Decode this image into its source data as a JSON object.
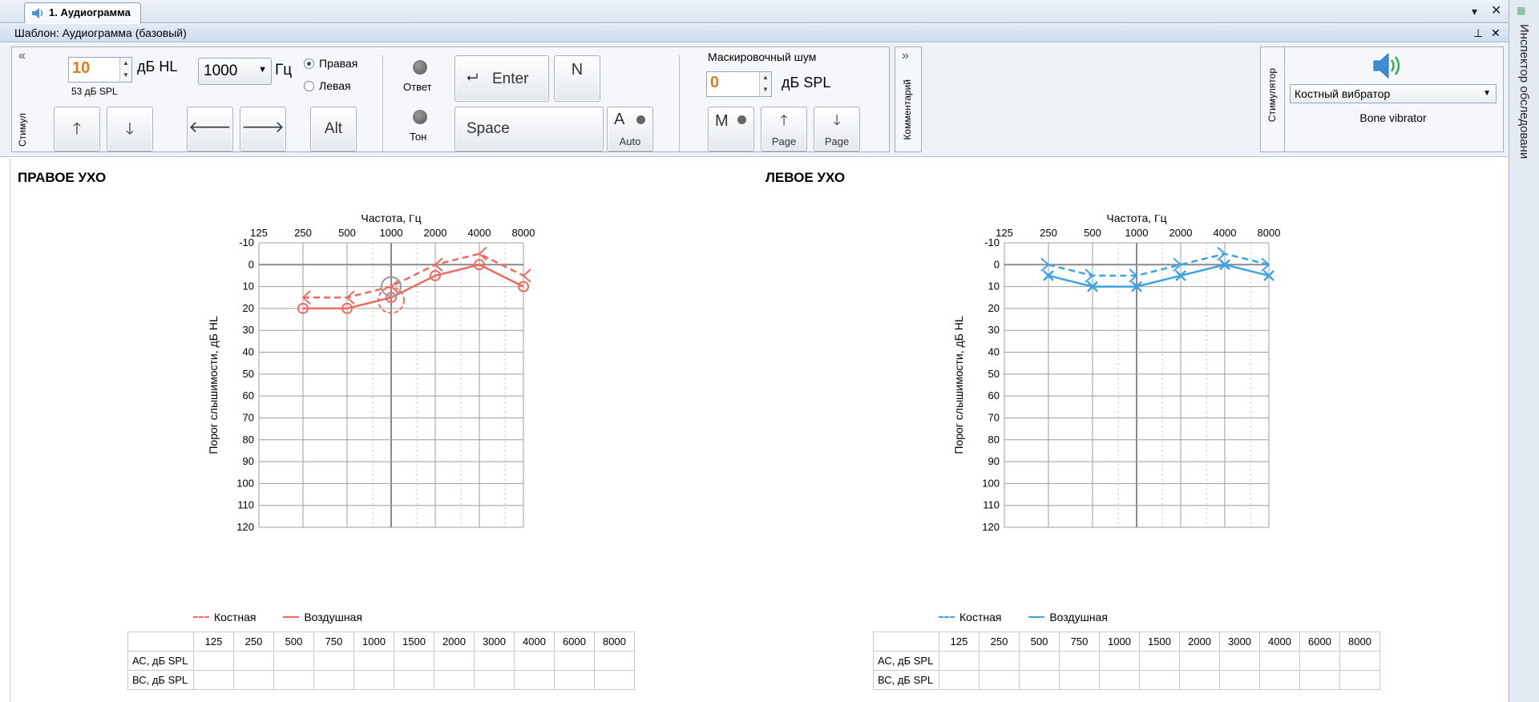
{
  "tab": {
    "title": "1. Аудиограмма",
    "icon": "speaker-icon"
  },
  "template_bar": {
    "text": "Шаблон: Аудиограмма (базовый)"
  },
  "stimulus": {
    "panel_label": "Стимул",
    "level_value": "10",
    "level_unit": "дБ HL",
    "spl_text": "53 дБ SPL",
    "freq_value": "1000",
    "freq_unit": "Гц",
    "ear_right": "Правая",
    "ear_left": "Левая",
    "ear_selected": "right",
    "answer_label": "Ответ",
    "tone_label": "Тон",
    "enter_label": "Enter",
    "space_label": "Space",
    "n_label": "N",
    "alt_label": "Alt",
    "auto_label": "Auto",
    "auto_letter": "A",
    "mask_title": "Маскировочный шум",
    "mask_value": "0",
    "mask_unit": "дБ SPL",
    "m_label": "M",
    "page_up_label": "Page",
    "page_down_label": "Page"
  },
  "comment_panel": {
    "label": "Комментарий"
  },
  "stimulator": {
    "panel_label": "Стимулятор",
    "device": "Костный вибратор",
    "device_caption": "Bone vibrator"
  },
  "inspector": {
    "label": "Инспектор обследовани"
  },
  "colors": {
    "right": "#ee6b63",
    "left": "#3da3e2",
    "accent_value": "#e07a1e"
  },
  "right_ear": {
    "title": "ПРАВОЕ УХО"
  },
  "left_ear": {
    "title": "ЛЕВОЕ УХО"
  },
  "legend": {
    "bone": "Костная",
    "air": "Воздушная"
  },
  "chart_data": [
    {
      "type": "line",
      "name": "right-ear",
      "xlabel": "Частота, Гц",
      "ylabel": "Порог слышимости, дБ HL",
      "x_ticks": [
        "125",
        "250",
        "500",
        "1000",
        "2000",
        "4000",
        "8000"
      ],
      "y_ticks": [
        -10,
        0,
        10,
        20,
        30,
        40,
        50,
        60,
        70,
        80,
        90,
        100,
        110,
        120
      ],
      "ylim": [
        -10,
        120
      ],
      "y_inverted": true,
      "x_scale": "log2",
      "grid": true,
      "legend_position": "bottom-left",
      "series": [
        {
          "name": "Костная",
          "style": "dashed",
          "marker": "<",
          "x": [
            250,
            500,
            1000,
            2000,
            4000,
            8000
          ],
          "y": [
            15,
            15,
            10,
            0,
            -5,
            5
          ]
        },
        {
          "name": "Воздушная",
          "style": "solid",
          "marker": "o",
          "x": [
            250,
            500,
            1000,
            2000,
            4000,
            8000
          ],
          "y": [
            20,
            20,
            15,
            5,
            0,
            10
          ]
        }
      ],
      "cursor": {
        "x": 1000,
        "y": 10
      }
    },
    {
      "type": "line",
      "name": "left-ear",
      "xlabel": "Частота, Гц",
      "ylabel": "Порог слышимости, дБ HL",
      "x_ticks": [
        "125",
        "250",
        "500",
        "1000",
        "2000",
        "4000",
        "8000"
      ],
      "y_ticks": [
        -10,
        0,
        10,
        20,
        30,
        40,
        50,
        60,
        70,
        80,
        90,
        100,
        110,
        120
      ],
      "ylim": [
        -10,
        120
      ],
      "y_inverted": true,
      "x_scale": "log2",
      "grid": true,
      "legend_position": "bottom-left",
      "series": [
        {
          "name": "Костная",
          "style": "dashed",
          "marker": ">",
          "x": [
            250,
            500,
            1000,
            2000,
            4000,
            8000
          ],
          "y": [
            0,
            5,
            5,
            0,
            -5,
            0
          ]
        },
        {
          "name": "Воздушная",
          "style": "solid",
          "marker": "x",
          "x": [
            250,
            500,
            1000,
            2000,
            4000,
            8000
          ],
          "y": [
            5,
            10,
            10,
            5,
            0,
            5
          ]
        }
      ]
    }
  ],
  "db_table": {
    "columns": [
      "125",
      "250",
      "500",
      "750",
      "1000",
      "1500",
      "2000",
      "3000",
      "4000",
      "6000",
      "8000"
    ],
    "rows": [
      "АС, дБ SPL",
      "ВС, дБ SPL"
    ]
  }
}
